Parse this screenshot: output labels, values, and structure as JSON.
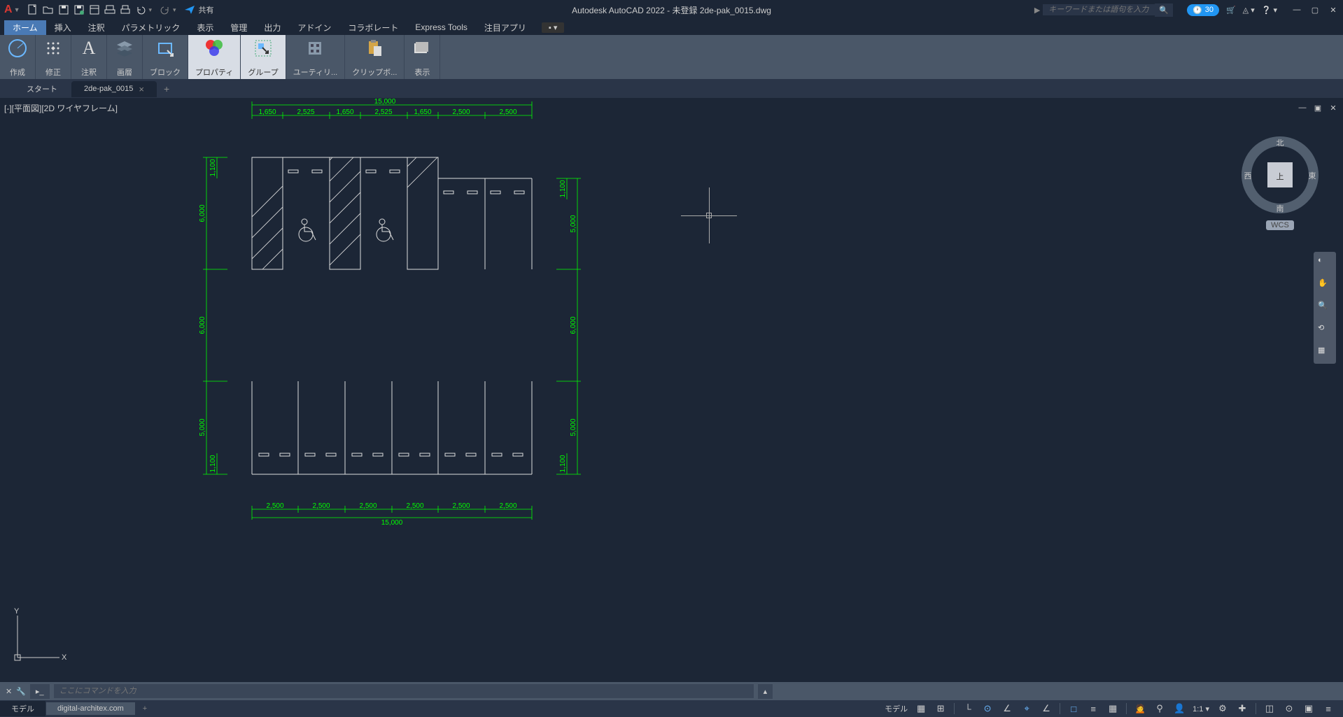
{
  "app": {
    "title": "Autodesk AutoCAD 2022 - 未登録   2de-pak_0015.dwg",
    "share": "共有",
    "search_placeholder": "キーワードまたは語句を入力",
    "trial_days": "30"
  },
  "menu": {
    "items": [
      "ホーム",
      "挿入",
      "注釈",
      "パラメトリック",
      "表示",
      "管理",
      "出力",
      "アドイン",
      "コラボレート",
      "Express Tools",
      "注目アプリ"
    ]
  },
  "ribbon": {
    "panels": [
      "作成",
      "修正",
      "注釈",
      "画層",
      "ブロック",
      "プロパティ",
      "グループ",
      "ユーティリ...",
      "クリップボ...",
      "表示"
    ]
  },
  "tabs": {
    "start": "スタート",
    "file": "2de-pak_0015"
  },
  "viewport": {
    "label": "[-][平面図][2D ワイヤフレーム]"
  },
  "viewcube": {
    "n": "北",
    "s": "南",
    "e": "東",
    "w": "西",
    "top": "上",
    "wcs": "WCS"
  },
  "cmdline": {
    "placeholder": "ここにコマンドを入力"
  },
  "status": {
    "model": "モデル",
    "layout": "digital-architex.com",
    "scale": "1:1"
  },
  "dims": {
    "top_total": "15,000",
    "top": [
      "1,650",
      "2,525",
      "1,650",
      "2,525",
      "1,650",
      "2,500",
      "2,500"
    ],
    "bottom_total": "15,000",
    "bottom": [
      "2,500",
      "2,500",
      "2,500",
      "2,500",
      "2,500",
      "2,500"
    ],
    "left_upper": "6,000",
    "left_upper_ext": "1,100",
    "left_mid": "6,000",
    "left_lower": "5,000",
    "left_lower_ext": "1,100",
    "right_upper": "5,000",
    "right_upper_ext": "1,100",
    "right_mid": "6,000",
    "right_lower": "5,000",
    "right_lower_ext": "1,100"
  }
}
